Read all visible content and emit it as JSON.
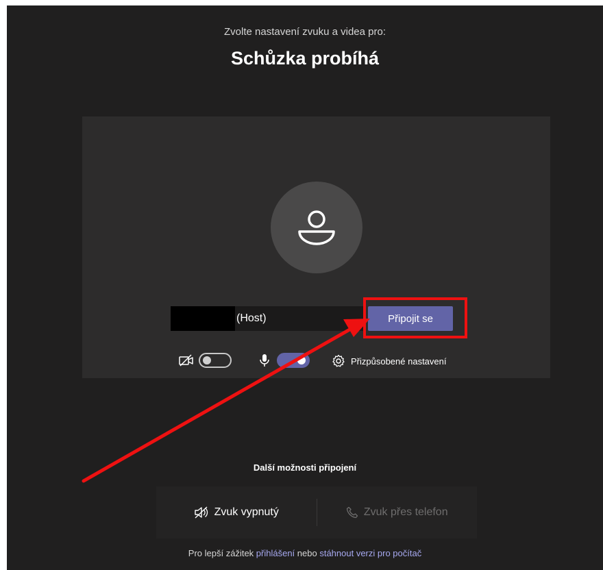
{
  "header": {
    "subtitle": "Zvolte nastavení zvuku a videa pro:",
    "title": "Schůzka probíhá"
  },
  "preview": {
    "name_suffix": "(Host)",
    "join_label": "Připojit se",
    "video_toggle": "off",
    "mic_toggle": "on",
    "settings_label": "Přizpůsobené nastavení"
  },
  "more_options": {
    "title": "Další možnosti připojení",
    "audio_off_label": "Zvuk vypnutý",
    "phone_audio_label": "Zvuk přes telefon"
  },
  "footer": {
    "prefix": "Pro lepší zážitek",
    "login_link": "přihlášení",
    "or_text": "nebo",
    "download_link": "stáhnout verzi pro počítač"
  },
  "colors": {
    "background": "#201f1f",
    "panel": "#2d2c2c",
    "accent": "#6264a7",
    "highlight": "#ee1111",
    "link": "#a7a9f0"
  },
  "icons": [
    "avatar-person-icon",
    "video-off-icon",
    "microphone-icon",
    "gear-icon",
    "speaker-off-icon",
    "phone-icon"
  ]
}
